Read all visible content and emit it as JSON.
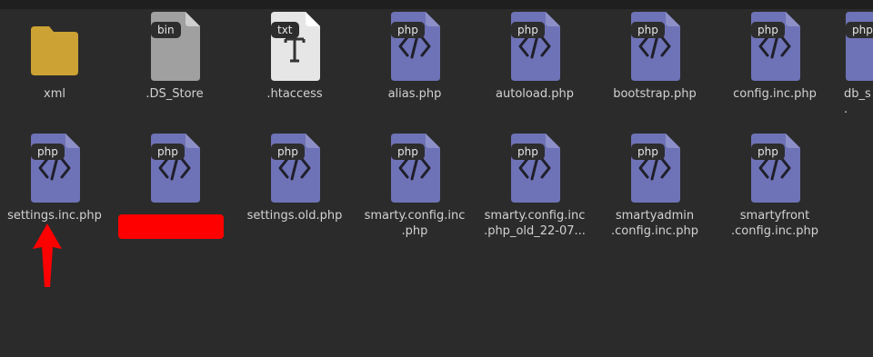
{
  "colors": {
    "background": "#2b2b2b",
    "folder": "#cba233",
    "php_file": "#6e72b6",
    "bin_file": "#a0a0a0",
    "txt_file": "#e6e6e6",
    "annotation": "#ff0000"
  },
  "row1": [
    {
      "type": "folder",
      "label": "xml",
      "icon": "folder-icon"
    },
    {
      "type": "bin",
      "badge": "bin",
      "label": ".DS_Store",
      "icon": "bin-file-icon"
    },
    {
      "type": "txt",
      "badge": "txt",
      "label": ".htaccess",
      "icon": "text-file-icon"
    },
    {
      "type": "php",
      "badge": "php",
      "label": "alias.php",
      "icon": "php-file-icon"
    },
    {
      "type": "php",
      "badge": "php",
      "label": "autoload.php",
      "icon": "php-file-icon"
    },
    {
      "type": "php",
      "badge": "php",
      "label": "bootstrap.php",
      "icon": "php-file-icon"
    },
    {
      "type": "php",
      "badge": "php",
      "label": "config.inc.php",
      "icon": "php-file-icon"
    },
    {
      "type": "php",
      "badge": "php",
      "label": "db_s\n.",
      "icon": "php-file-icon"
    }
  ],
  "row2": [
    {
      "type": "php",
      "badge": "php",
      "label": "settings.inc.php",
      "icon": "php-file-icon"
    },
    {
      "type": "php",
      "badge": "php",
      "label": "",
      "icon": "php-file-icon"
    },
    {
      "type": "php",
      "badge": "php",
      "label": "settings.old.php",
      "icon": "php-file-icon"
    },
    {
      "type": "php",
      "badge": "php",
      "label": "smarty.config.inc\n.php",
      "icon": "php-file-icon"
    },
    {
      "type": "php",
      "badge": "php",
      "label": "smarty.config.inc\n.php_old_22-07...",
      "icon": "php-file-icon"
    },
    {
      "type": "php",
      "badge": "php",
      "label": "smartyadmin\n.config.inc.php",
      "icon": "php-file-icon"
    },
    {
      "type": "php",
      "badge": "php",
      "label": "smartyfront\n.config.inc.php",
      "icon": "php-file-icon"
    }
  ],
  "annotations": {
    "arrow_icon": "up-arrow-icon",
    "redaction": "redaction-bar"
  }
}
